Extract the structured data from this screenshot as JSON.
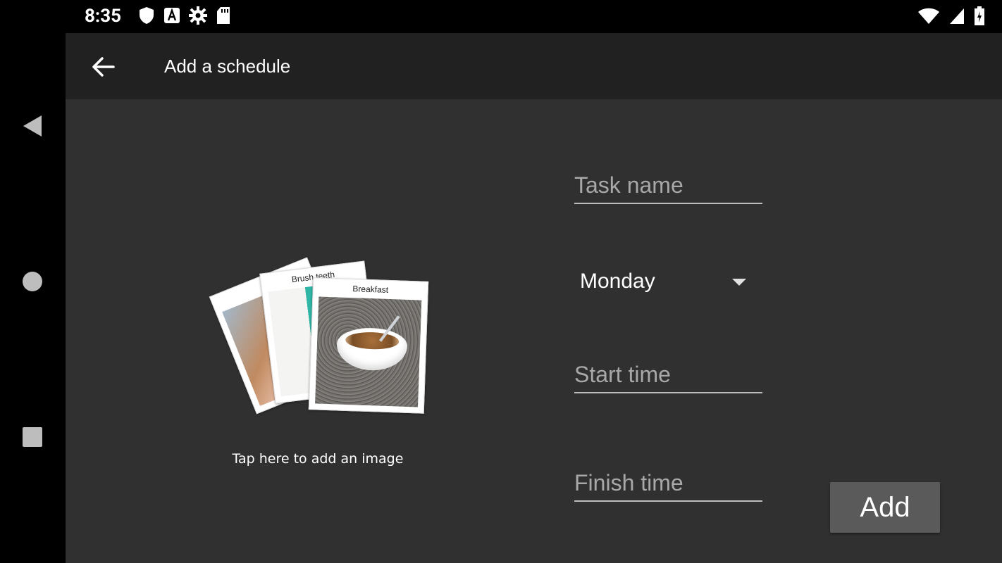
{
  "status_bar": {
    "time": "8:35",
    "left_icons": [
      "shield-icon",
      "font-a-icon",
      "gear-icon",
      "sd-card-icon"
    ],
    "right_icons": [
      "wifi-icon",
      "signal-icon",
      "battery-icon"
    ]
  },
  "toolbar": {
    "title": "Add a schedule"
  },
  "image_picker": {
    "cards": [
      {
        "title": ""
      },
      {
        "title": "Brush teeth"
      },
      {
        "title": "Breakfast"
      }
    ],
    "caption": "Tap here to add an image"
  },
  "form": {
    "task_name": {
      "placeholder": "Task name",
      "value": ""
    },
    "day": {
      "value": "Monday"
    },
    "start_time": {
      "placeholder": "Start time",
      "value": ""
    },
    "finish_time": {
      "placeholder": "Finish time",
      "value": ""
    },
    "add_label": "Add"
  },
  "nav": {
    "buttons": [
      "back-icon",
      "home-icon",
      "recents-icon"
    ]
  }
}
